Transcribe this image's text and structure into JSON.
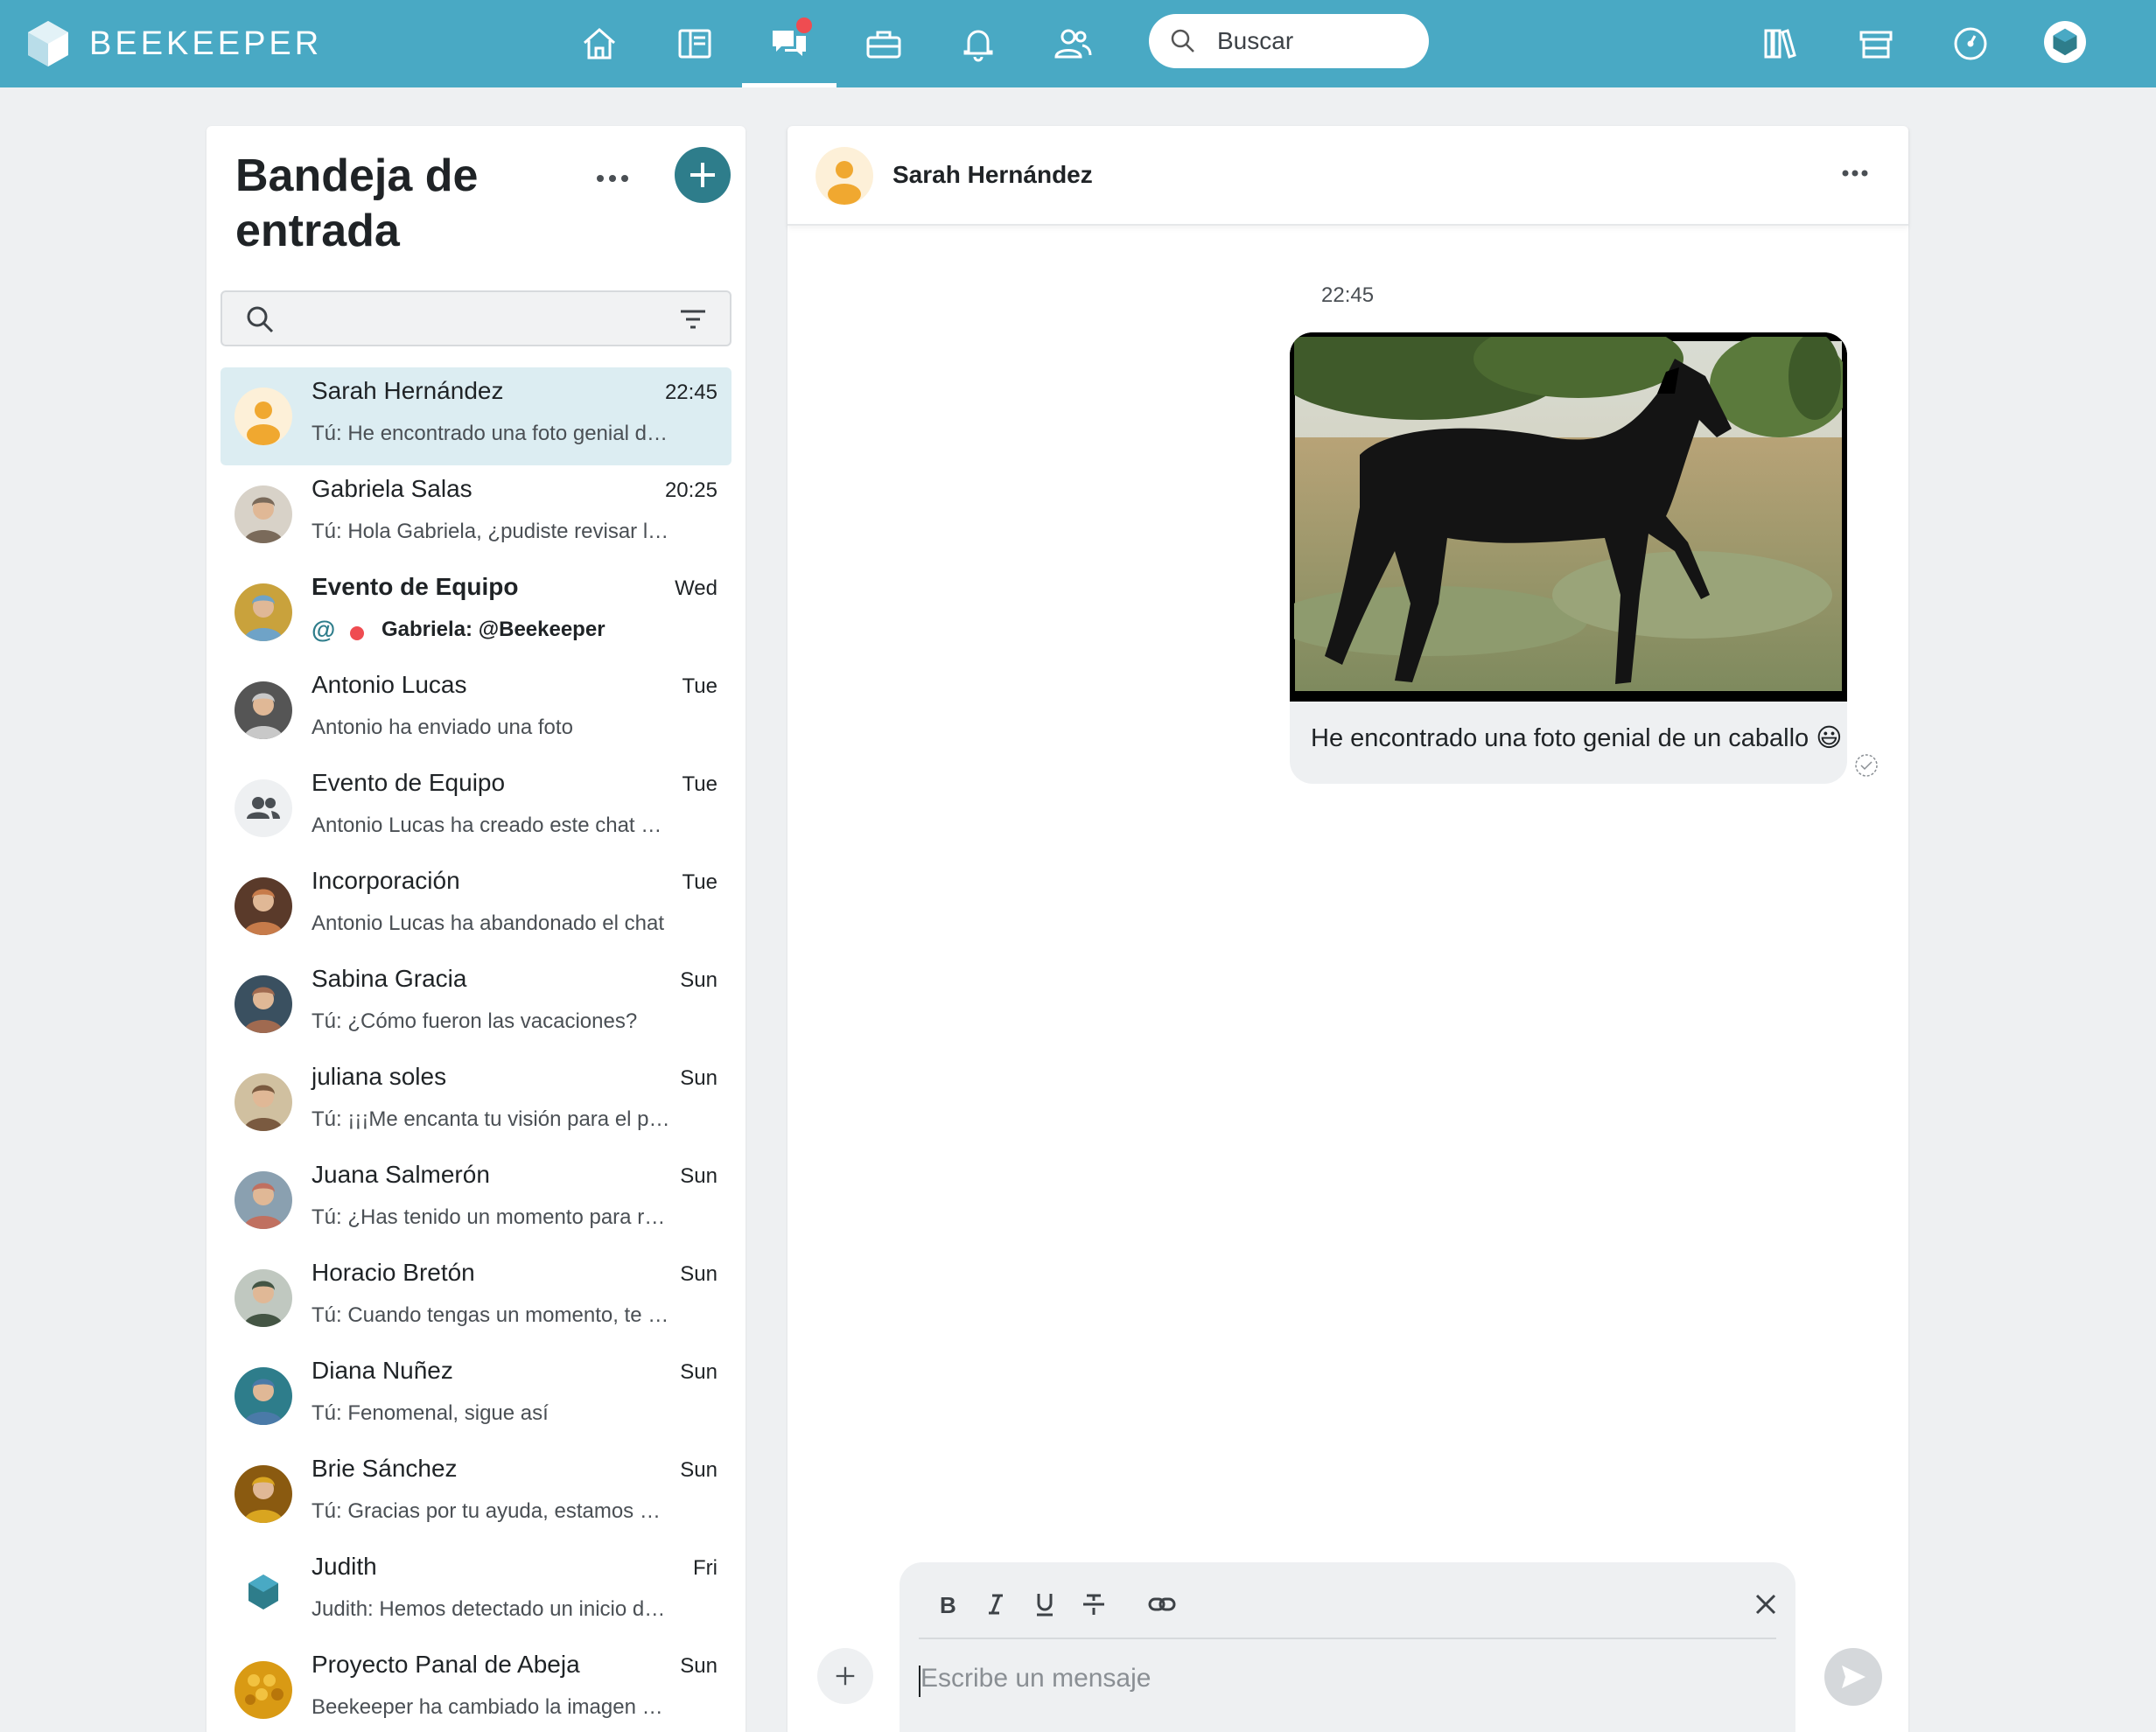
{
  "app": {
    "brand": "BEEKEEPER",
    "accent_color": "#49a9c4",
    "nav": [
      {
        "icon": "home-icon"
      },
      {
        "icon": "news-feed-icon"
      },
      {
        "icon": "chat-icon",
        "active": true,
        "has_notification": true
      },
      {
        "icon": "toolbox-icon"
      },
      {
        "icon": "notifications-bell-icon"
      },
      {
        "icon": "people-icon"
      }
    ],
    "search_placeholder": "Buscar",
    "right_nav": [
      {
        "icon": "library-icon"
      },
      {
        "icon": "store-icon"
      },
      {
        "icon": "dashboard-icon"
      },
      {
        "icon": "profile-avatar-icon"
      }
    ]
  },
  "inbox": {
    "title": "Bandeja de entrada",
    "conversations": [
      {
        "name": "Sarah Hernández",
        "time": "22:45",
        "preview": "Tú: He encontrado una foto genial de un caballo",
        "selected": true,
        "avatar": "default-user"
      },
      {
        "name": "Gabriela Salas",
        "time": "20:25",
        "preview": "Tú: Hola Gabriela, ¿pudiste revisar los documentos?",
        "avatar": "photo"
      },
      {
        "name": "Evento de Equipo",
        "time": "Wed",
        "preview": "Gabriela: @Beekeeper",
        "mention": "@",
        "unread": true,
        "avatar": "photo"
      },
      {
        "name": "Antonio Lucas",
        "time": "Tue",
        "preview": "Antonio ha enviado una foto",
        "avatar": "photo"
      },
      {
        "name": "Evento de Equipo",
        "time": "Tue",
        "preview": "Antonio Lucas ha creado este chat de grupo",
        "avatar": "group"
      },
      {
        "name": "Incorporación",
        "time": "Tue",
        "preview": "Antonio Lucas ha abandonado el chat",
        "avatar": "photo"
      },
      {
        "name": "Sabina Gracia",
        "time": "Sun",
        "preview": "Tú: ¿Cómo fueron las vacaciones?",
        "avatar": "photo"
      },
      {
        "name": "juliana soles",
        "time": "Sun",
        "preview": "Tú: ¡¡¡Me encanta tu visión para el proyecto!!!",
        "avatar": "photo"
      },
      {
        "name": "Juana Salmerón",
        "time": "Sun",
        "preview": "Tú: ¿Has tenido un momento para revisarlo?",
        "avatar": "photo"
      },
      {
        "name": "Horacio Bretón",
        "time": "Sun",
        "preview": "Tú: Cuando tengas un momento, te llamo",
        "avatar": "photo"
      },
      {
        "name": "Diana Nuñez",
        "time": "Sun",
        "preview": "Tú: Fenomenal, sigue así",
        "avatar": "photo"
      },
      {
        "name": "Brie Sánchez",
        "time": "Sun",
        "preview": "Tú: Gracias por tu ayuda, estamos encantados",
        "avatar": "photo"
      },
      {
        "name": "Judith",
        "time": "Fri",
        "preview": "Judith: Hemos detectado un inicio de sesión",
        "avatar": "hexagon"
      },
      {
        "name": "Proyecto Panal de Abeja",
        "time": "Sun",
        "preview": "Beekeeper ha cambiado la imagen del grupo",
        "avatar": "honeycomb"
      }
    ]
  },
  "chat": {
    "contact_name": "Sarah Hernández",
    "message_time": "22:45",
    "message_text": "He encontrado una foto genial de un caballo 😃",
    "message_image": "black-horse-photo",
    "composer_placeholder": "Escribe un mensaje",
    "toolbar": [
      "bold-icon",
      "italic-icon",
      "underline-icon",
      "strikethrough-icon",
      "link-icon",
      "close-icon"
    ]
  }
}
